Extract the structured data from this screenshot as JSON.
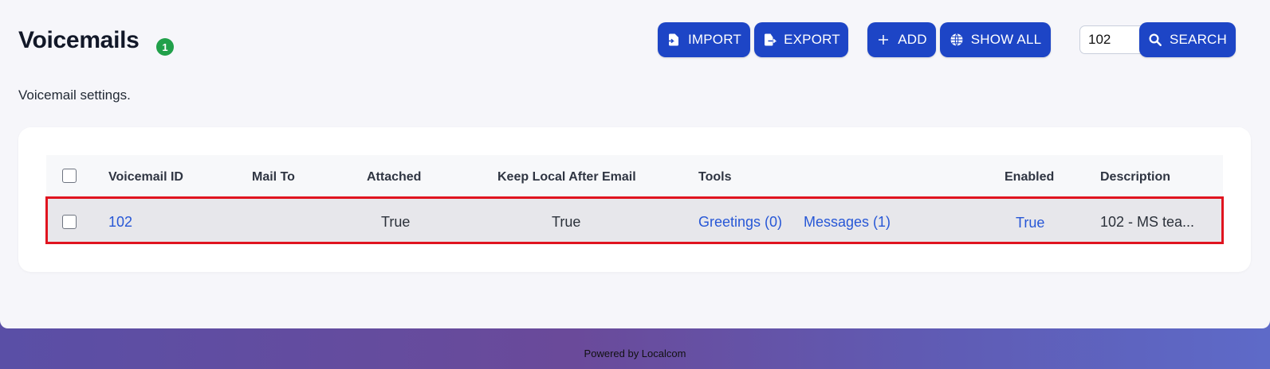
{
  "header": {
    "title": "Voicemails",
    "count_badge": "1",
    "subtitle": "Voicemail settings."
  },
  "toolbar": {
    "import_label": "IMPORT",
    "export_label": "EXPORT",
    "add_label": "ADD",
    "show_all_label": "SHOW ALL",
    "search_value": "102",
    "search_label": "SEARCH"
  },
  "table": {
    "columns": [
      "Voicemail ID",
      "Mail To",
      "Attached",
      "Keep Local After Email",
      "Tools",
      "Enabled",
      "Description"
    ],
    "rows": [
      {
        "voicemail_id": "102",
        "mail_to": "",
        "attached": "True",
        "keep_local": "True",
        "tools_greetings": "Greetings (0)",
        "tools_messages": "Messages (1)",
        "enabled": "True",
        "description": "102 - MS tea..."
      }
    ]
  },
  "footer": {
    "text": "Powered by Localcom"
  },
  "colors": {
    "primary_button": "#1d45c6",
    "badge": "#21a04a",
    "link": "#2757d6",
    "highlight_border": "#e0141f"
  }
}
